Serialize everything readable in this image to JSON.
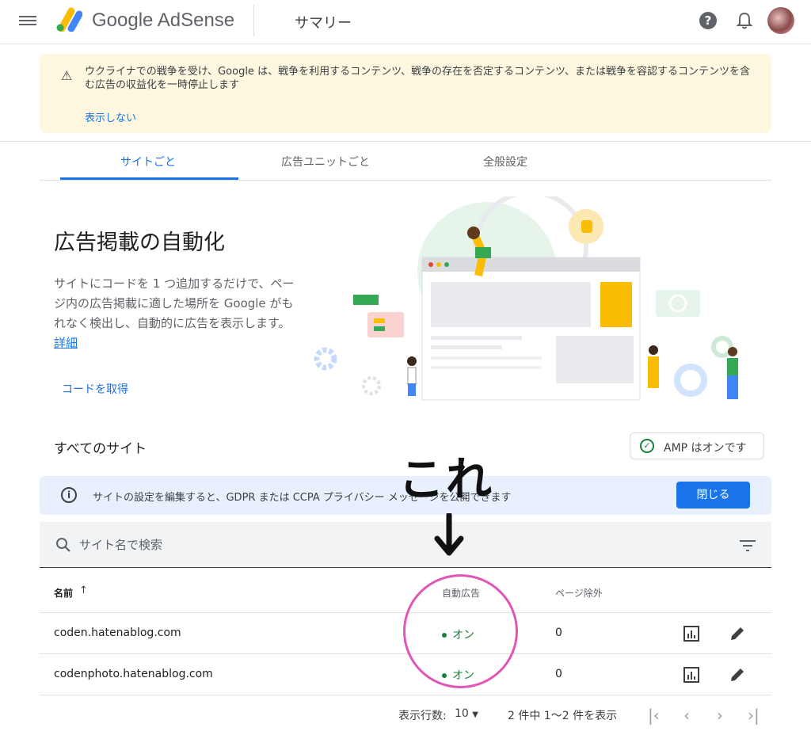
{
  "header": {
    "brand": "Google AdSense",
    "title": "サマリー"
  },
  "warning": {
    "text": "ウクライナでの戦争を受け、Google は、戦争を利用するコンテンツ、戦争の存在を否定するコンテンツ、または戦争を容認するコンテンツを含む広告の収益化を一時停止します",
    "dismiss_label": "表示しない"
  },
  "tabs": [
    {
      "label": "サイトごと",
      "active": true
    },
    {
      "label": "広告ユニットごと",
      "active": false
    },
    {
      "label": "全般設定",
      "active": false
    }
  ],
  "hero": {
    "title": "広告掲載の自動化",
    "description": "サイトにコードを 1 つ追加するだけで、ページ内の広告掲載に適した場所を Google がもれなく検出し、自動的に広告を表示します。",
    "learn_more": "詳細",
    "get_code": "コードを取得"
  },
  "sites": {
    "heading": "すべてのサイト",
    "amp_status": "AMP はオンです",
    "info_text": "サイトの設定を編集すると、GDPR または CCPA プライバシー メッセージを公開できます",
    "close_label": "閉じる",
    "search_placeholder": "サイト名で検索",
    "columns": {
      "name": "名前",
      "sort_arrow": "↑",
      "auto_ads": "自動広告",
      "page_exclusions": "ページ除外"
    },
    "rows": [
      {
        "name": "coden.hatenablog.com",
        "auto_ads": "オン",
        "exclusions": "0"
      },
      {
        "name": "codenphoto.hatenablog.com",
        "auto_ads": "オン",
        "exclusions": "0"
      }
    ]
  },
  "pagination": {
    "rows_label": "表示行数:",
    "rows_value": "10",
    "range": "2 件中 1〜2 件を表示"
  },
  "annotation": {
    "text": "これ"
  },
  "colors": {
    "accent": "#1a73e8",
    "status_on": "#188038",
    "warning_bg": "#fef7e0",
    "annotation_circle": "#e056b5"
  }
}
